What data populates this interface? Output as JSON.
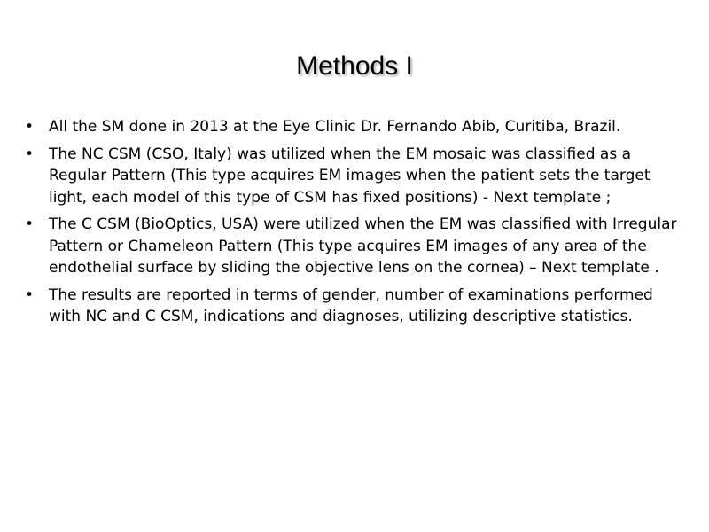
{
  "slide": {
    "title": "Methods I",
    "bullet_marker": "•",
    "bullets": [
      {
        "text": "All the SM done in 2013 at the Eye Clinic Dr. Fernando Abib, Curitiba, Brazil."
      },
      {
        "text": "The NC CSM (CSO, Italy) was utilized when the EM mosaic was classified as a Regular Pattern (This type acquires EM images when the patient sets the target light, each model of this type of CSM has fixed positions) - Next template ;"
      },
      {
        "text": "The C CSM (BioOptics, USA) were utilized when the EM was classified with Irregular Pattern or Chameleon Pattern (This type acquires EM images of any area of the endothelial surface by sliding the objective lens on the cornea) – Next template ."
      },
      {
        "text": "The results are reported in terms of gender, number of examinations performed with NC and C CSM, indications and diagnoses, utilizing descriptive statistics."
      }
    ]
  }
}
